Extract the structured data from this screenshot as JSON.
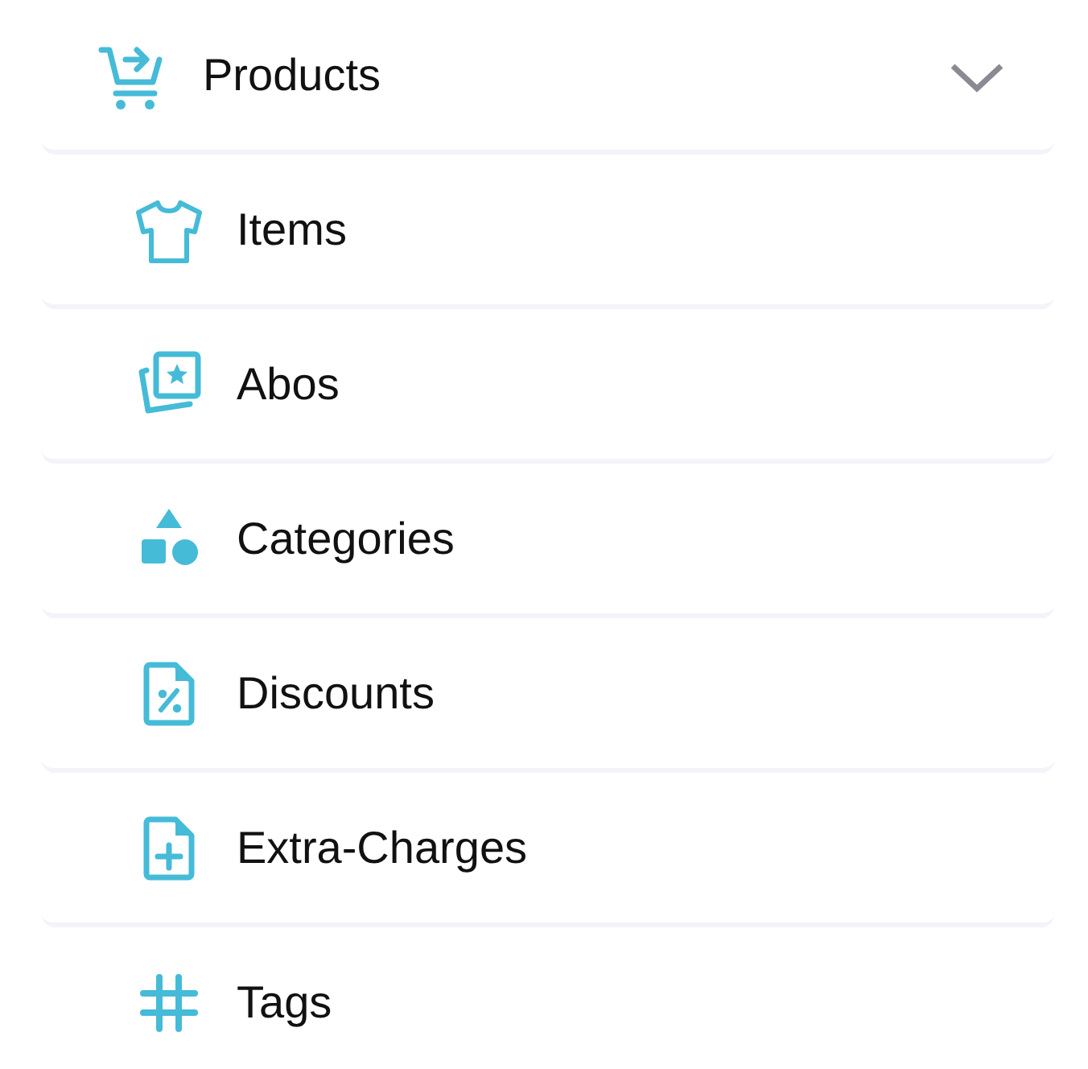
{
  "menu": {
    "label": "Products",
    "expanded": true,
    "items": [
      {
        "label": "Items"
      },
      {
        "label": "Abos"
      },
      {
        "label": "Categories"
      },
      {
        "label": "Discounts"
      },
      {
        "label": "Extra-Charges"
      },
      {
        "label": "Tags"
      }
    ]
  }
}
